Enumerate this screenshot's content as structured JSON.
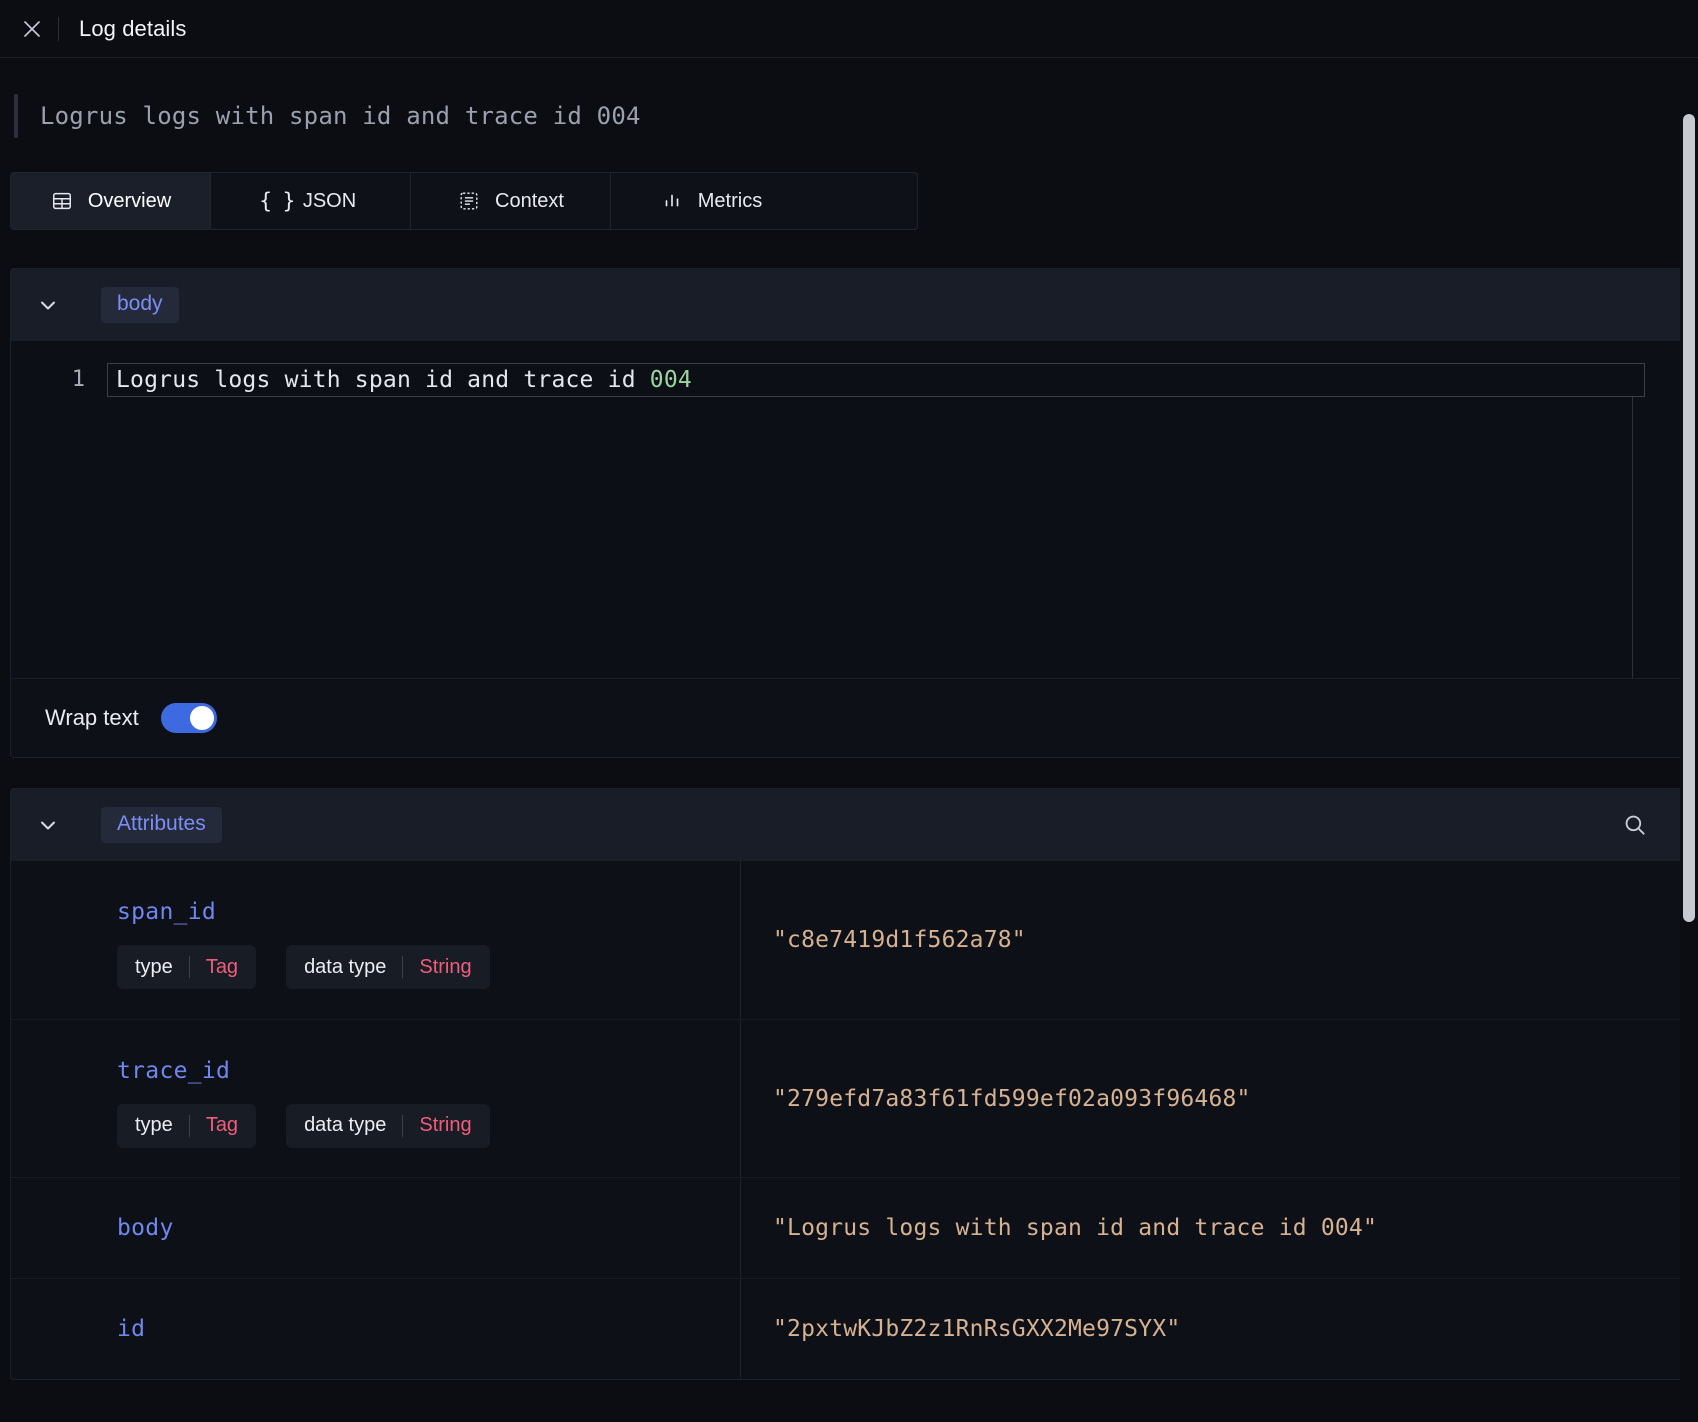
{
  "header": {
    "close_icon": "close-icon",
    "title": "Log details"
  },
  "log_preview": {
    "text": "Logrus logs with span id and trace id 004"
  },
  "tabs": [
    {
      "label": "Overview",
      "icon": "table-icon",
      "active": true
    },
    {
      "label": "JSON",
      "icon": "braces-icon",
      "active": false
    },
    {
      "label": "Context",
      "icon": "list-dashed-icon",
      "active": false
    },
    {
      "label": "Metrics",
      "icon": "bar-chart-icon",
      "active": false
    }
  ],
  "body_section": {
    "chevron_icon": "chevron-down-icon",
    "pill_label": "body",
    "editor": {
      "line_number": "1",
      "text_prefix": "Logrus logs with span id and trace id ",
      "text_number": "004"
    },
    "wrap_text": {
      "label": "Wrap text",
      "enabled": true
    }
  },
  "attributes_section": {
    "chevron_icon": "chevron-down-icon",
    "pill_label": "Attributes",
    "search_icon": "search-icon",
    "chip_labels": {
      "type": "type",
      "data_type": "data type"
    },
    "rows": [
      {
        "key": "span_id",
        "type_value": "Tag",
        "data_type_value": "String",
        "value": "\"c8e7419d1f562a78\"",
        "has_chips": true
      },
      {
        "key": "trace_id",
        "type_value": "Tag",
        "data_type_value": "String",
        "value": "\"279efd7a83f61fd599ef02a093f96468\"",
        "has_chips": true
      },
      {
        "key": "body",
        "type_value": "",
        "data_type_value": "",
        "value": "\"Logrus logs with span id and trace id 004\"",
        "has_chips": false
      },
      {
        "key": "id",
        "type_value": "",
        "data_type_value": "",
        "value": "\"2pxtwKJbZ2z1RnRsGXX2Me97SYX\"",
        "has_chips": false
      }
    ]
  },
  "colors": {
    "background": "#0b0d12",
    "accent_blue": "#6f87ee",
    "toggle_on": "#3d6ae0",
    "value_tan": "#d6b293",
    "chip_value_pink": "#ef5d7a",
    "code_number_green": "#9ad4a0"
  }
}
